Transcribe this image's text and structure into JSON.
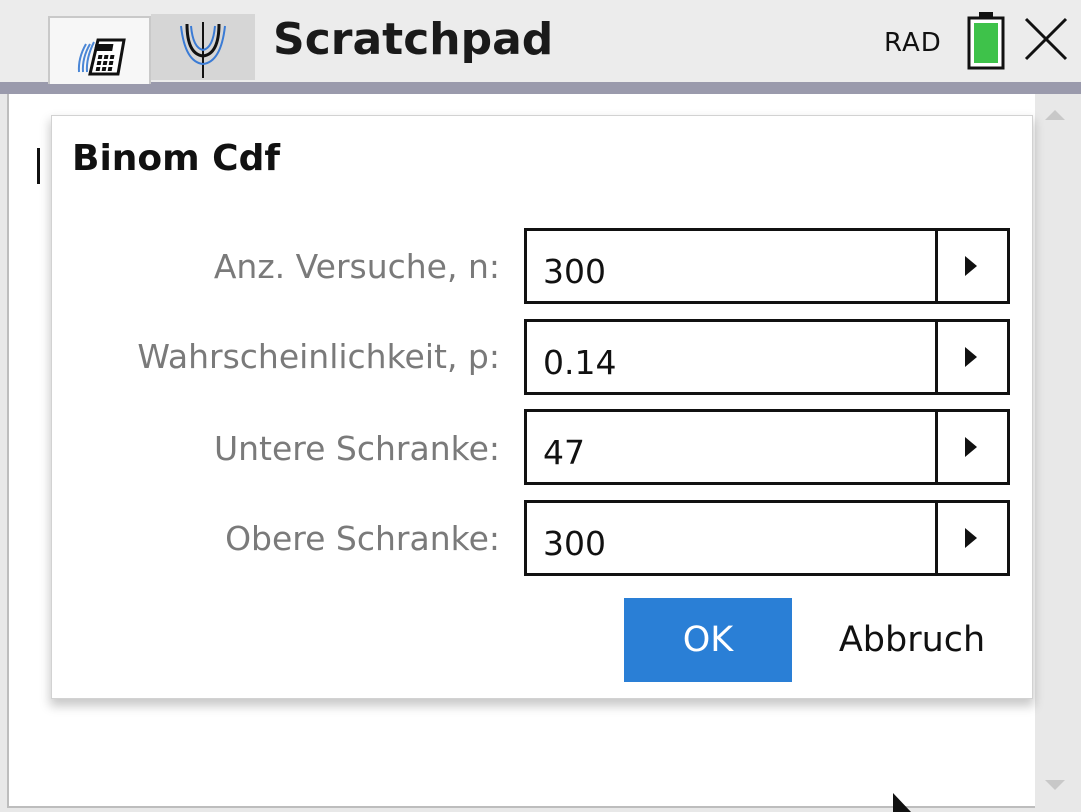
{
  "header": {
    "title": "Scratchpad",
    "angle_mode": "RAD",
    "tabs": [
      {
        "icon": "calculator-icon",
        "active": true
      },
      {
        "icon": "graph-icon",
        "active": false
      }
    ],
    "battery_icon": "battery-full-icon",
    "close_icon": "close-icon"
  },
  "dialog": {
    "title": "Binom Cdf",
    "fields": [
      {
        "label": "Anz. Versuche, n:",
        "value": "300"
      },
      {
        "label": "Wahrscheinlichkeit, p:",
        "value": "0.14"
      },
      {
        "label": "Untere Schranke:",
        "value": "47"
      },
      {
        "label": "Obere Schranke:",
        "value": "300"
      }
    ],
    "ok_label": "OK",
    "cancel_label": "Abbruch"
  },
  "colors": {
    "accent": "#2a7fd6",
    "battery": "#3ec24a",
    "divider": "#9a9aac",
    "label_text": "#7a7a7a"
  }
}
